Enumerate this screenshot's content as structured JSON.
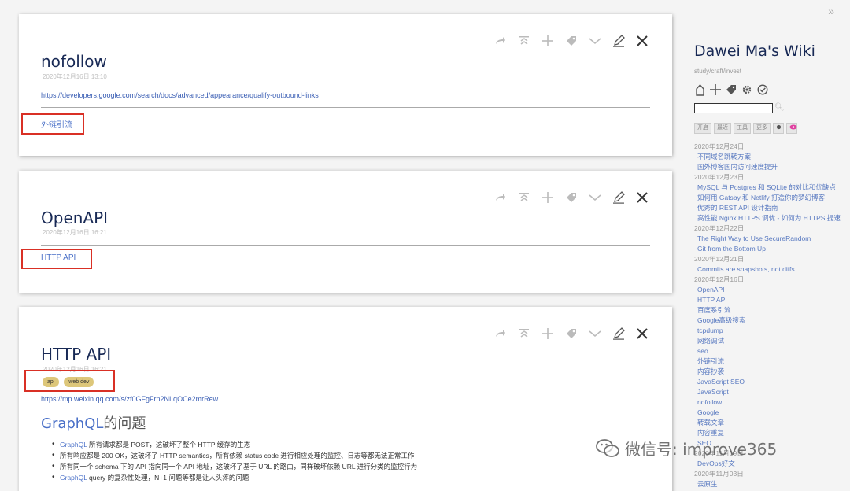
{
  "tiddlers": [
    {
      "title": "nofollow",
      "subtitle": "2020年12月16日 13:10",
      "url": "https://developers.google.com/search/docs/advanced/appearance/qualify-outbound-links",
      "tag_link": "外链引流"
    },
    {
      "title": "OpenAPI",
      "subtitle": "2020年12月16日 16:21",
      "tag_link": "HTTP API"
    },
    {
      "title": "HTTP API",
      "subtitle": "2020年12月16日 16:21",
      "tags": [
        "api",
        "web dev"
      ],
      "url": "https://mp.weixin.qq.com/s/zf0GFgFrn2NLqOCe2mrRew",
      "heading_link": "GraphQL",
      "heading_rest": "的问题",
      "bullets": [
        {
          "link": "GraphQL",
          "text": " 所有请求都是 POST，这破坏了整个 HTTP 缓存的生态"
        },
        {
          "link": "",
          "text": "所有响应都是 200 OK，这破坏了 HTTP semantics，所有依赖 status code 进行相应处理的监控、日志等都无法正常工作"
        },
        {
          "link": "",
          "text": "所有同一个 schema 下的 API 指向同一个 API 地址，这破坏了基于 URL 的路由，同样破坏依赖 URL 进行分类的监控行为"
        },
        {
          "link": "GraphQL",
          "text": " query 的复杂性处理，N+1 问题等都是让人头疼的问题"
        }
      ]
    }
  ],
  "sidebar": {
    "toggle": "»",
    "site_title": "Dawei Ma's Wiki",
    "site_subtitle": "study/craft/invest",
    "tabs": [
      "开启",
      "最近",
      "工具",
      "更多"
    ],
    "list": [
      {
        "type": "date",
        "text": "2020年12月24日"
      },
      {
        "type": "item",
        "text": "不同域名跳转方案"
      },
      {
        "type": "item",
        "text": "国外博客国内访问速度提升"
      },
      {
        "type": "date",
        "text": "2020年12月23日"
      },
      {
        "type": "item",
        "text": "MySQL 与 Postgres 和 SQLite 的对比和优缺点"
      },
      {
        "type": "item",
        "text": "如何用 Gatsby 和 Netlify 打造你的梦幻博客"
      },
      {
        "type": "item",
        "text": "优秀的 REST API 设计指南"
      },
      {
        "type": "item",
        "text": "高性能 Nginx HTTPS 调优 - 如何为 HTTPS 提速"
      },
      {
        "type": "date",
        "text": "2020年12月22日"
      },
      {
        "type": "item",
        "text": "The Right Way to Use SecureRandom"
      },
      {
        "type": "item",
        "text": "Git from the Bottom Up"
      },
      {
        "type": "date",
        "text": "2020年12月21日"
      },
      {
        "type": "item",
        "text": "Commits are snapshots, not diffs"
      },
      {
        "type": "date",
        "text": "2020年12月16日"
      },
      {
        "type": "item",
        "text": "OpenAPI"
      },
      {
        "type": "item",
        "text": "HTTP API"
      },
      {
        "type": "item",
        "text": "百度系引流"
      },
      {
        "type": "item",
        "text": "Google高级搜索"
      },
      {
        "type": "item",
        "text": "tcpdump"
      },
      {
        "type": "item",
        "text": "网络调试"
      },
      {
        "type": "item",
        "text": "seo"
      },
      {
        "type": "item",
        "text": "外链引流"
      },
      {
        "type": "item",
        "text": "内容抄袭"
      },
      {
        "type": "item",
        "text": "JavaScript SEO"
      },
      {
        "type": "item",
        "text": "JavaScript"
      },
      {
        "type": "item",
        "text": "nofollow"
      },
      {
        "type": "item",
        "text": "Google"
      },
      {
        "type": "item",
        "text": "转载文章"
      },
      {
        "type": "item",
        "text": "内容重复"
      },
      {
        "type": "item",
        "text": "SEO"
      },
      {
        "type": "date",
        "text": "2020年11月19日"
      },
      {
        "type": "item",
        "text": "DevOps好文"
      },
      {
        "type": "date",
        "text": "2020年11月03日"
      },
      {
        "type": "item",
        "text": "云原生"
      }
    ]
  },
  "watermark": "微信号: improve365",
  "colors": {
    "title": "#182955",
    "link": "#4a70c8",
    "highlight": "#d93025",
    "tag_pill": "#ddc77a"
  }
}
